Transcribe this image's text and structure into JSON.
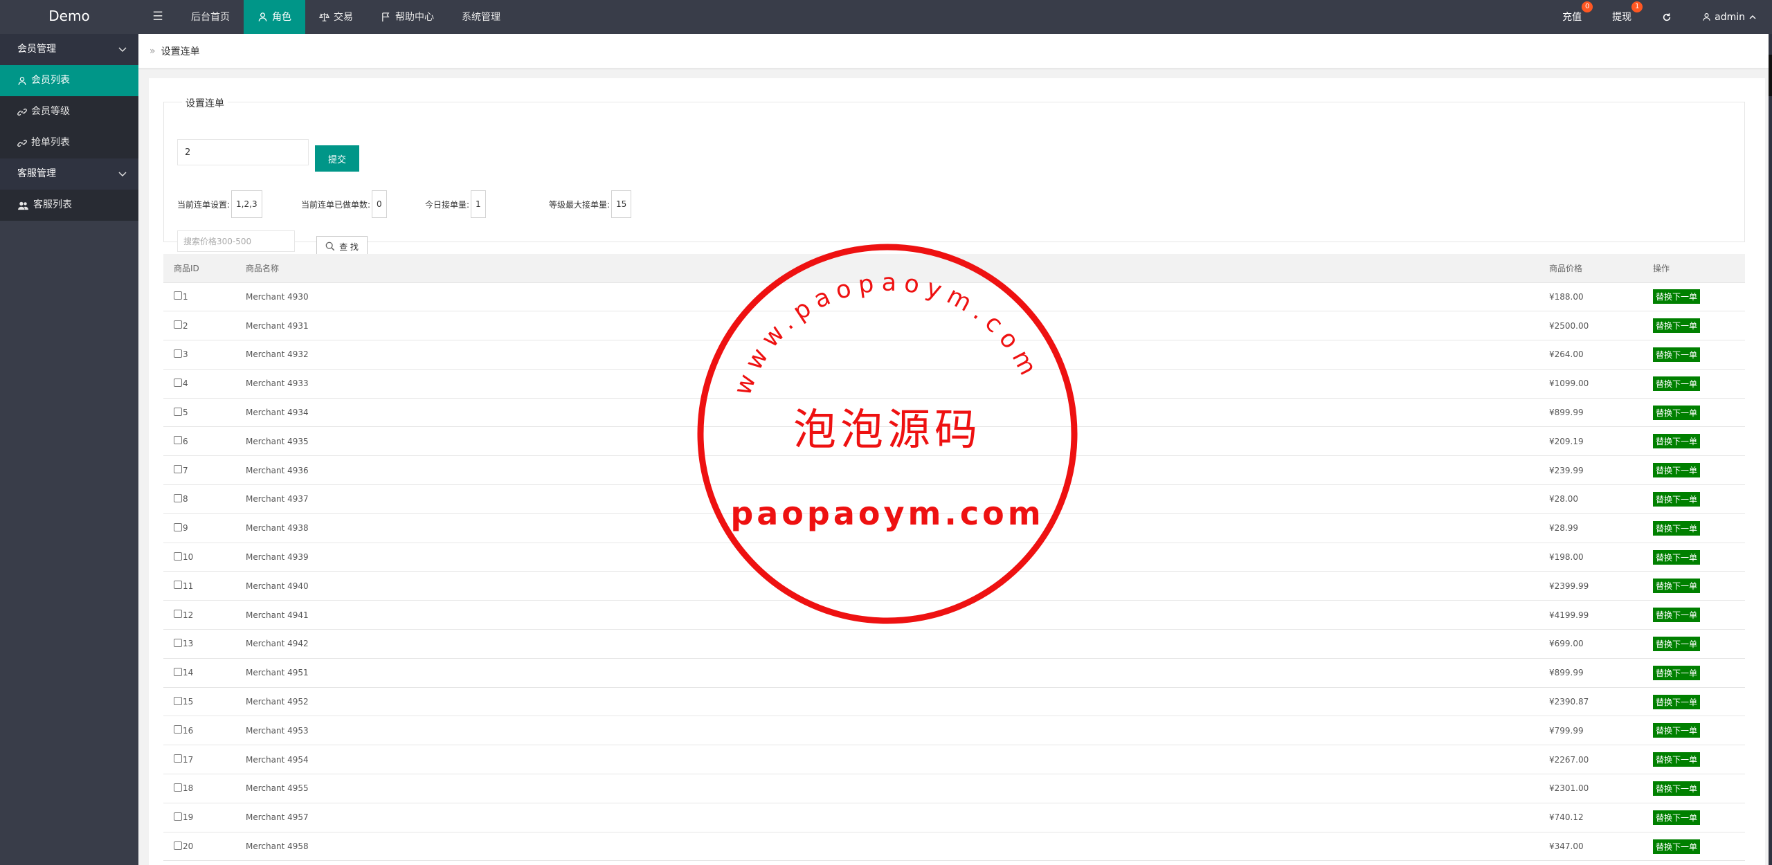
{
  "app": {
    "logo": "Demo"
  },
  "topnav": [
    {
      "label": "后台首页",
      "icon": "none"
    },
    {
      "label": "角色",
      "icon": "user-icon",
      "active": true
    },
    {
      "label": "交易",
      "icon": "scale-icon"
    },
    {
      "label": "帮助中心",
      "icon": "flag-icon"
    },
    {
      "label": "系统管理",
      "icon": "none"
    }
  ],
  "right_nav": {
    "recharge": {
      "label": "充值",
      "badge": "0"
    },
    "withdraw": {
      "label": "提现",
      "badge": "1"
    },
    "user": "admin"
  },
  "sidebar": {
    "groups": [
      {
        "label": "会员管理",
        "items": [
          "会员列表",
          "会员等级",
          "抢单列表"
        ]
      },
      {
        "label": "客服管理",
        "items": [
          "客服列表"
        ]
      }
    ]
  },
  "breadcrumb": "设置连单",
  "form": {
    "legend": "设置连单",
    "input_value": "2",
    "submit_label": "提交",
    "stats": [
      {
        "label": "当前连单设置:",
        "value": "1,2,3"
      },
      {
        "label": "当前连单已做单数:",
        "value": "0"
      },
      {
        "label": "今日接单量:",
        "value": "1"
      },
      {
        "label": "等级最大接单量:",
        "value": "15"
      }
    ],
    "search_placeholder": "搜索价格300-500",
    "search_label": "查 找"
  },
  "table": {
    "headers": [
      "商品ID",
      "商品名称",
      "商品价格",
      "操作"
    ],
    "action_label": "替换下一单",
    "rows": [
      {
        "id": "1",
        "name": "Merchant 4930",
        "price": "¥188.00"
      },
      {
        "id": "2",
        "name": "Merchant 4931",
        "price": "¥2500.00"
      },
      {
        "id": "3",
        "name": "Merchant 4932",
        "price": "¥264.00"
      },
      {
        "id": "4",
        "name": "Merchant 4933",
        "price": "¥1099.00"
      },
      {
        "id": "5",
        "name": "Merchant 4934",
        "price": "¥899.99"
      },
      {
        "id": "6",
        "name": "Merchant 4935",
        "price": "¥209.19"
      },
      {
        "id": "7",
        "name": "Merchant 4936",
        "price": "¥239.99"
      },
      {
        "id": "8",
        "name": "Merchant 4937",
        "price": "¥28.00"
      },
      {
        "id": "9",
        "name": "Merchant 4938",
        "price": "¥28.99"
      },
      {
        "id": "10",
        "name": "Merchant 4939",
        "price": "¥198.00"
      },
      {
        "id": "11",
        "name": "Merchant 4940",
        "price": "¥2399.99"
      },
      {
        "id": "12",
        "name": "Merchant 4941",
        "price": "¥4199.99"
      },
      {
        "id": "13",
        "name": "Merchant 4942",
        "price": "¥699.00"
      },
      {
        "id": "14",
        "name": "Merchant 4951",
        "price": "¥899.99"
      },
      {
        "id": "15",
        "name": "Merchant 4952",
        "price": "¥2390.87"
      },
      {
        "id": "16",
        "name": "Merchant 4953",
        "price": "¥799.99"
      },
      {
        "id": "17",
        "name": "Merchant 4954",
        "price": "¥2267.00"
      },
      {
        "id": "18",
        "name": "Merchant 4955",
        "price": "¥2301.00"
      },
      {
        "id": "19",
        "name": "Merchant 4957",
        "price": "¥740.12"
      },
      {
        "id": "20",
        "name": "Merchant 4958",
        "price": "¥347.00"
      }
    ]
  },
  "watermark": {
    "arc_text": "www.paopaoym.com",
    "center_text": "泡泡源码",
    "bottom_text": "paopaoym.com",
    "color": "#ee1111"
  },
  "colors": {
    "accent": "#009688",
    "header": "#393d49",
    "action": "#008000",
    "badge": "#ff5722"
  }
}
